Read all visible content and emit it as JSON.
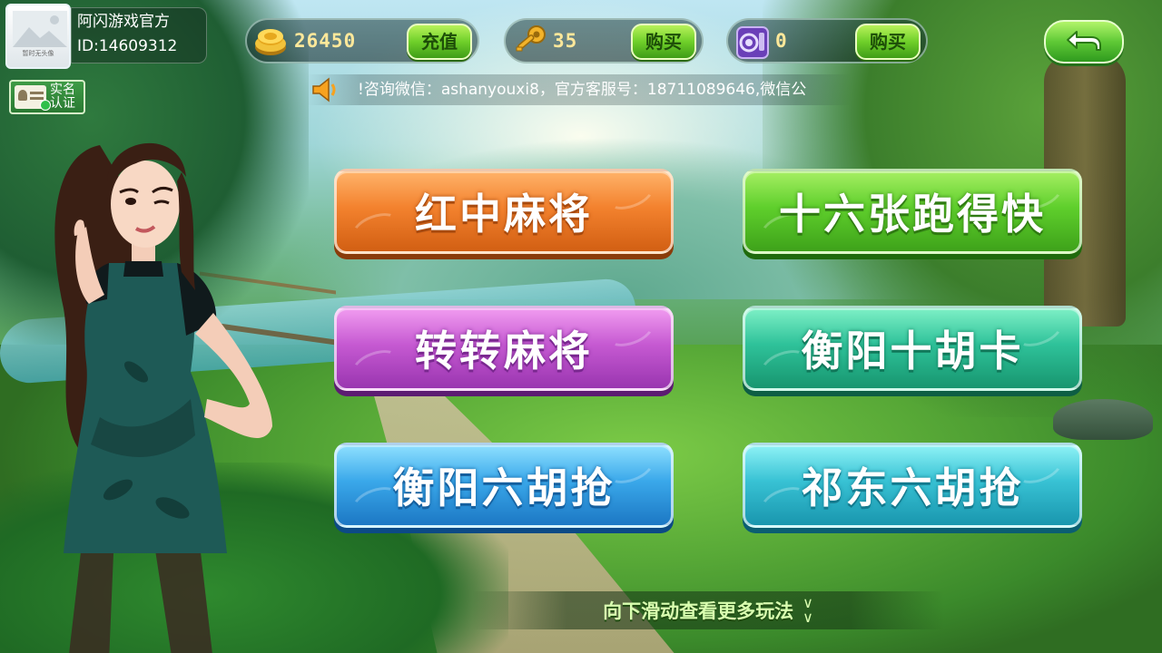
{
  "profile": {
    "name": "阿闪游戏官方",
    "id": "ID:14609312",
    "avatar_caption": "暂时无头像",
    "realname_label": "实名认证"
  },
  "resources": {
    "gold": {
      "value": "26450",
      "button": "充值",
      "icon": "gold-coin-icon"
    },
    "keys": {
      "value": "35",
      "button": "购买",
      "icon": "key-icon"
    },
    "cards": {
      "value": "0",
      "button": "购买",
      "icon": "room-card-icon"
    }
  },
  "notice": {
    "icon": "speaker-icon",
    "text": "!咨询微信：ashanyouxi8，官方客服号：18711089646,微信公"
  },
  "back_button": {
    "icon": "return-arrow-icon"
  },
  "games": [
    {
      "label": "红中麻将",
      "color": "#f3822e"
    },
    {
      "label": "十六张跑得快",
      "color": "#5fcf2c"
    },
    {
      "label": "转转麻将",
      "color": "#c65ad2"
    },
    {
      "label": "衡阳十胡卡",
      "color": "#2fc29a"
    },
    {
      "label": "衡阳六胡抢",
      "color": "#3aa8ea"
    },
    {
      "label": "祁东六胡抢",
      "color": "#38c2d4"
    }
  ],
  "hint": {
    "text": "向下滑动查看更多玩法",
    "icon": "double-chevron-down-icon"
  }
}
